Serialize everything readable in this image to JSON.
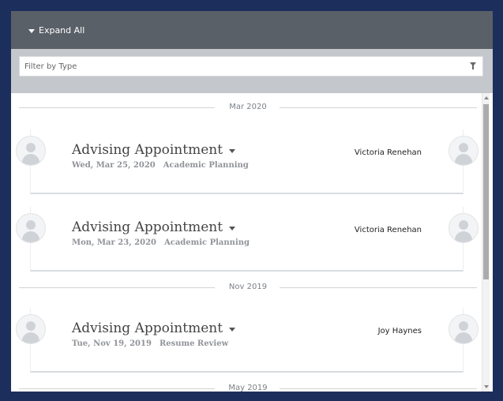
{
  "header": {
    "expand_label": "Expand All"
  },
  "filter": {
    "placeholder": "Filter by Type",
    "icon": "filter-icon"
  },
  "timeline": {
    "months": [
      {
        "label": "Mar 2020"
      },
      {
        "label": "Nov 2019"
      },
      {
        "label": "May 2019"
      }
    ],
    "appointments": [
      {
        "title": "Advising Appointment",
        "date": "Wed, Mar 25, 2020",
        "type": "Academic Planning",
        "advisor": "Victoria Renehan"
      },
      {
        "title": "Advising Appointment",
        "date": "Mon, Mar 23, 2020",
        "type": "Academic Planning",
        "advisor": "Victoria Renehan"
      },
      {
        "title": "Advising Appointment",
        "date": "Tue, Nov 19, 2019",
        "type": "Resume Review",
        "advisor": "Joy Haynes"
      }
    ]
  }
}
